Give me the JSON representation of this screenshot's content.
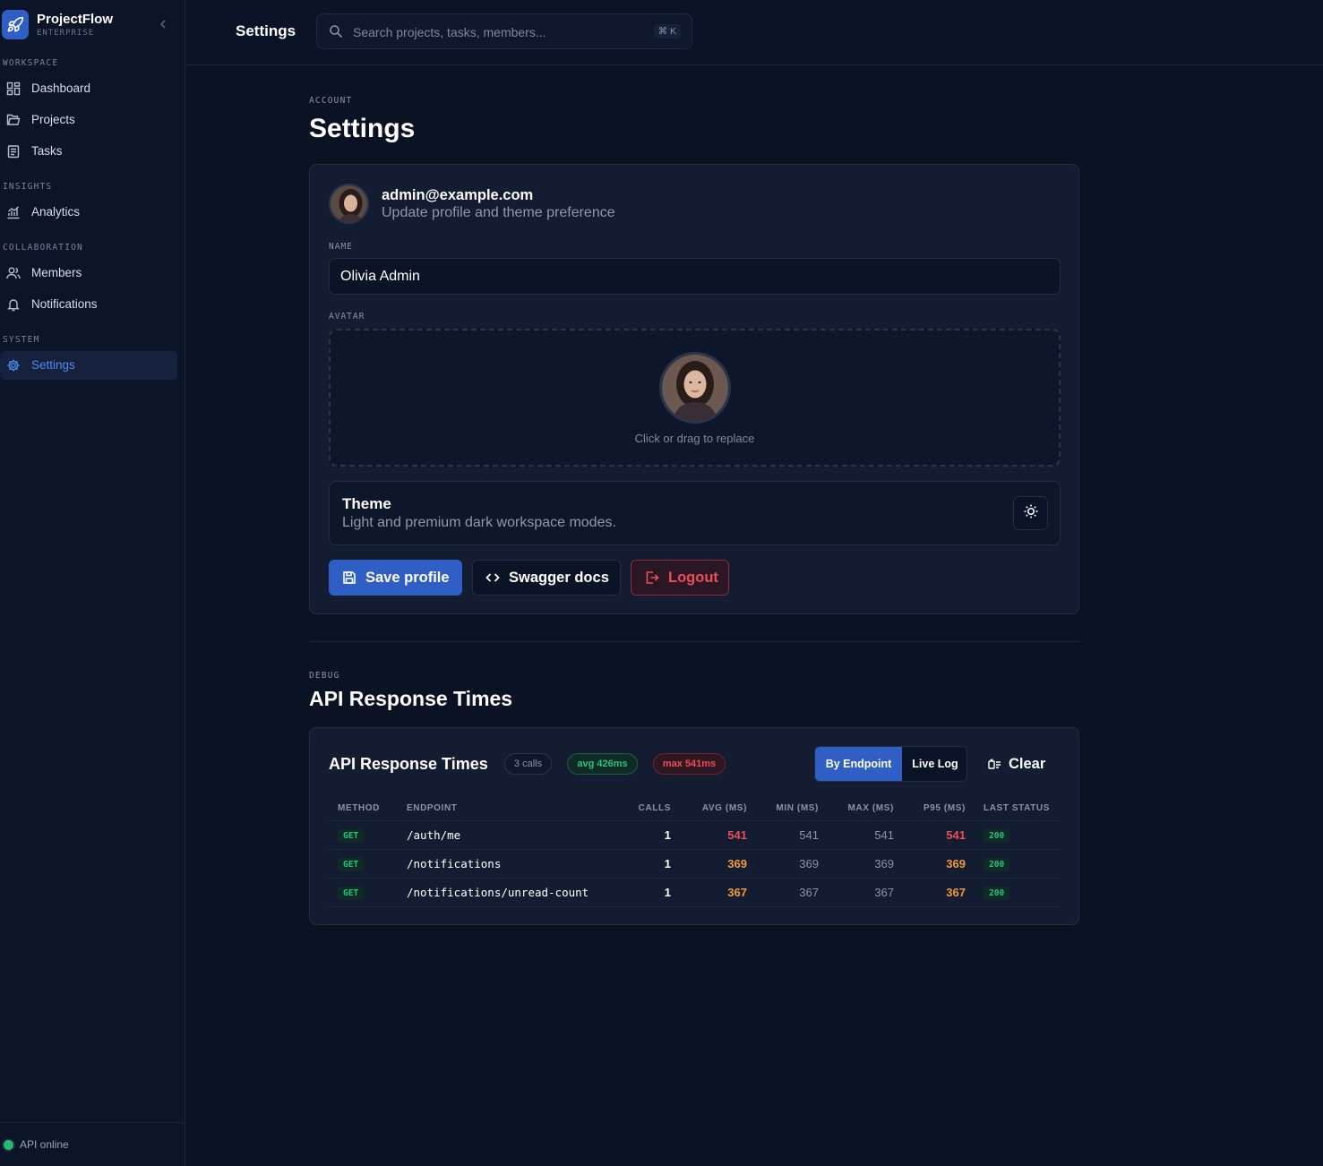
{
  "brand": {
    "name": "ProjectFlow",
    "sub": "ENTERPRISE"
  },
  "sidebar": {
    "sections": [
      {
        "title": "WORKSPACE",
        "items": [
          {
            "label": "Dashboard",
            "icon": "dashboard-icon"
          },
          {
            "label": "Projects",
            "icon": "folder-icon"
          },
          {
            "label": "Tasks",
            "icon": "clipboard-icon"
          }
        ]
      },
      {
        "title": "INSIGHTS",
        "items": [
          {
            "label": "Analytics",
            "icon": "analytics-icon"
          }
        ]
      },
      {
        "title": "COLLABORATION",
        "items": [
          {
            "label": "Members",
            "icon": "members-icon"
          },
          {
            "label": "Notifications",
            "icon": "bell-icon"
          }
        ]
      },
      {
        "title": "SYSTEM",
        "items": [
          {
            "label": "Settings",
            "icon": "gear-icon",
            "active": true
          }
        ]
      }
    ],
    "api_status": "API online"
  },
  "header": {
    "title": "Settings",
    "search": {
      "placeholder": "Search projects, tasks, members...",
      "shortcut": "⌘ K"
    }
  },
  "account": {
    "eyebrow": "ACCOUNT",
    "title": "Settings",
    "email": "admin@example.com",
    "subtitle": "Update profile and theme preference",
    "name_label": "NAME",
    "name_value": "Olivia Admin",
    "avatar_label": "AVATAR",
    "avatar_hint": "Click or drag to replace",
    "theme_title": "Theme",
    "theme_sub": "Light and premium dark workspace modes.",
    "buttons": {
      "save": "Save profile",
      "swagger": "Swagger docs",
      "logout": "Logout"
    }
  },
  "debug": {
    "eyebrow": "DEBUG",
    "title": "API Response Times",
    "card_title": "API Response Times",
    "pills": {
      "calls": "3 calls",
      "avg": "avg 426ms",
      "max": "max 541ms"
    },
    "tabs": {
      "by_endpoint": "By Endpoint",
      "live_log": "Live Log"
    },
    "clear": "Clear",
    "columns": [
      "METHOD",
      "ENDPOINT",
      "CALLS",
      "AVG (MS)",
      "MIN (MS)",
      "MAX (MS)",
      "P95 (MS)",
      "LAST STATUS"
    ],
    "rows": [
      {
        "method": "GET",
        "endpoint": "/auth/me",
        "calls": "1",
        "avg": "541",
        "min": "541",
        "max": "541",
        "p95": "541",
        "status": "200",
        "severity": "red"
      },
      {
        "method": "GET",
        "endpoint": "/notifications",
        "calls": "1",
        "avg": "369",
        "min": "369",
        "max": "369",
        "p95": "369",
        "status": "200",
        "severity": "orange"
      },
      {
        "method": "GET",
        "endpoint": "/notifications/unread-count",
        "calls": "1",
        "avg": "367",
        "min": "367",
        "max": "367",
        "p95": "367",
        "status": "200",
        "severity": "orange"
      }
    ]
  },
  "colors": {
    "accent": "#2f5ec4",
    "danger": "#ef4c5a",
    "warning": "#f29a3a",
    "success": "#2bc27a",
    "background": "#0a1224"
  }
}
